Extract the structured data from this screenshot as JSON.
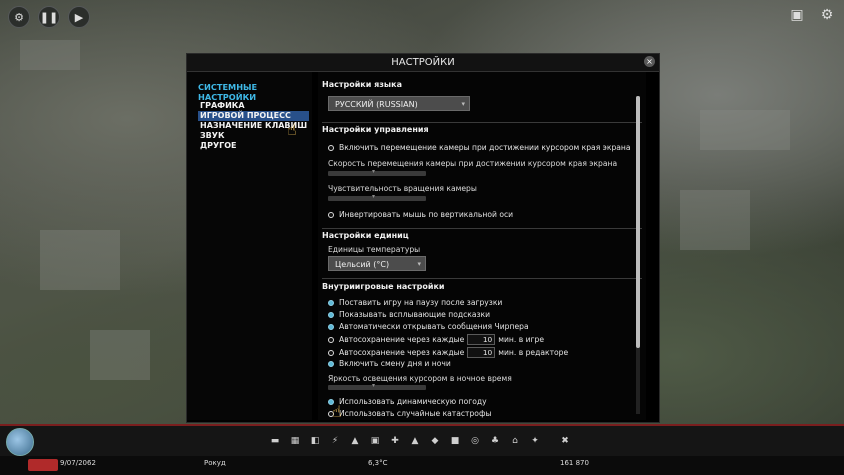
{
  "dialog": {
    "title": "НАСТРОЙКИ",
    "close_icon": "×"
  },
  "sidebar": {
    "header": "СИСТЕМНЫЕ НАСТРОЙКИ",
    "items": [
      {
        "label": "ГРАФИКА",
        "active": false
      },
      {
        "label": "ИГРОВОЙ ПРОЦЕСС",
        "active": true
      },
      {
        "label": "НАЗНАЧЕНИЕ КЛАВИШ",
        "active": false
      },
      {
        "label": "ЗВУК",
        "active": false
      },
      {
        "label": "ДРУГОЕ",
        "active": false
      }
    ]
  },
  "language": {
    "title": "Настройки языка",
    "value": "РУССКИЙ (RUSSIAN)"
  },
  "controls": {
    "title": "Настройки управления",
    "edge_scroll": "Включить перемещение камеры при достижении курсором края экрана",
    "edge_speed": "Скорость перемещения камеры при достижении курсором края экрана",
    "rotation": "Чувствительность вращения камеры",
    "invert_y": "Инвертировать мышь по вертикальной оси"
  },
  "units": {
    "title": "Настройки единиц",
    "temp_label": "Единицы температуры",
    "temp_value": "Цельсий (°C)"
  },
  "ingame": {
    "title": "Внутриигровые настройки",
    "pause": "Поставить игру на паузу после загрузки",
    "tooltips": "Показывать всплывающие подсказки",
    "chirper": "Автоматически открывать сообщения Чирпера",
    "autosave_game_prefix": "Автосохранение через каждые",
    "autosave_game_value": "10",
    "autosave_game_suffix": "мин. в игре",
    "autosave_editor_prefix": "Автосохранение через каждые",
    "autosave_editor_value": "10",
    "autosave_editor_suffix": "мин. в редакторе",
    "daynight": "Включить смену дня и ночи",
    "night_brightness": "Яркость освещения курсором в ночное время",
    "weather": "Использовать динамическую погоду",
    "disasters": "Использовать случайные катастрофы"
  },
  "hud": {
    "date": "9/07/2062",
    "district": "Рокуд",
    "temperature": "6,3°C",
    "population": "161 870"
  },
  "icons": {
    "top_left": [
      "gear-icon",
      "pause-icon",
      "play-icon"
    ],
    "top_right": [
      "camera-icon",
      "gear-icon"
    ],
    "cursor": "hand-pointer-icon"
  }
}
